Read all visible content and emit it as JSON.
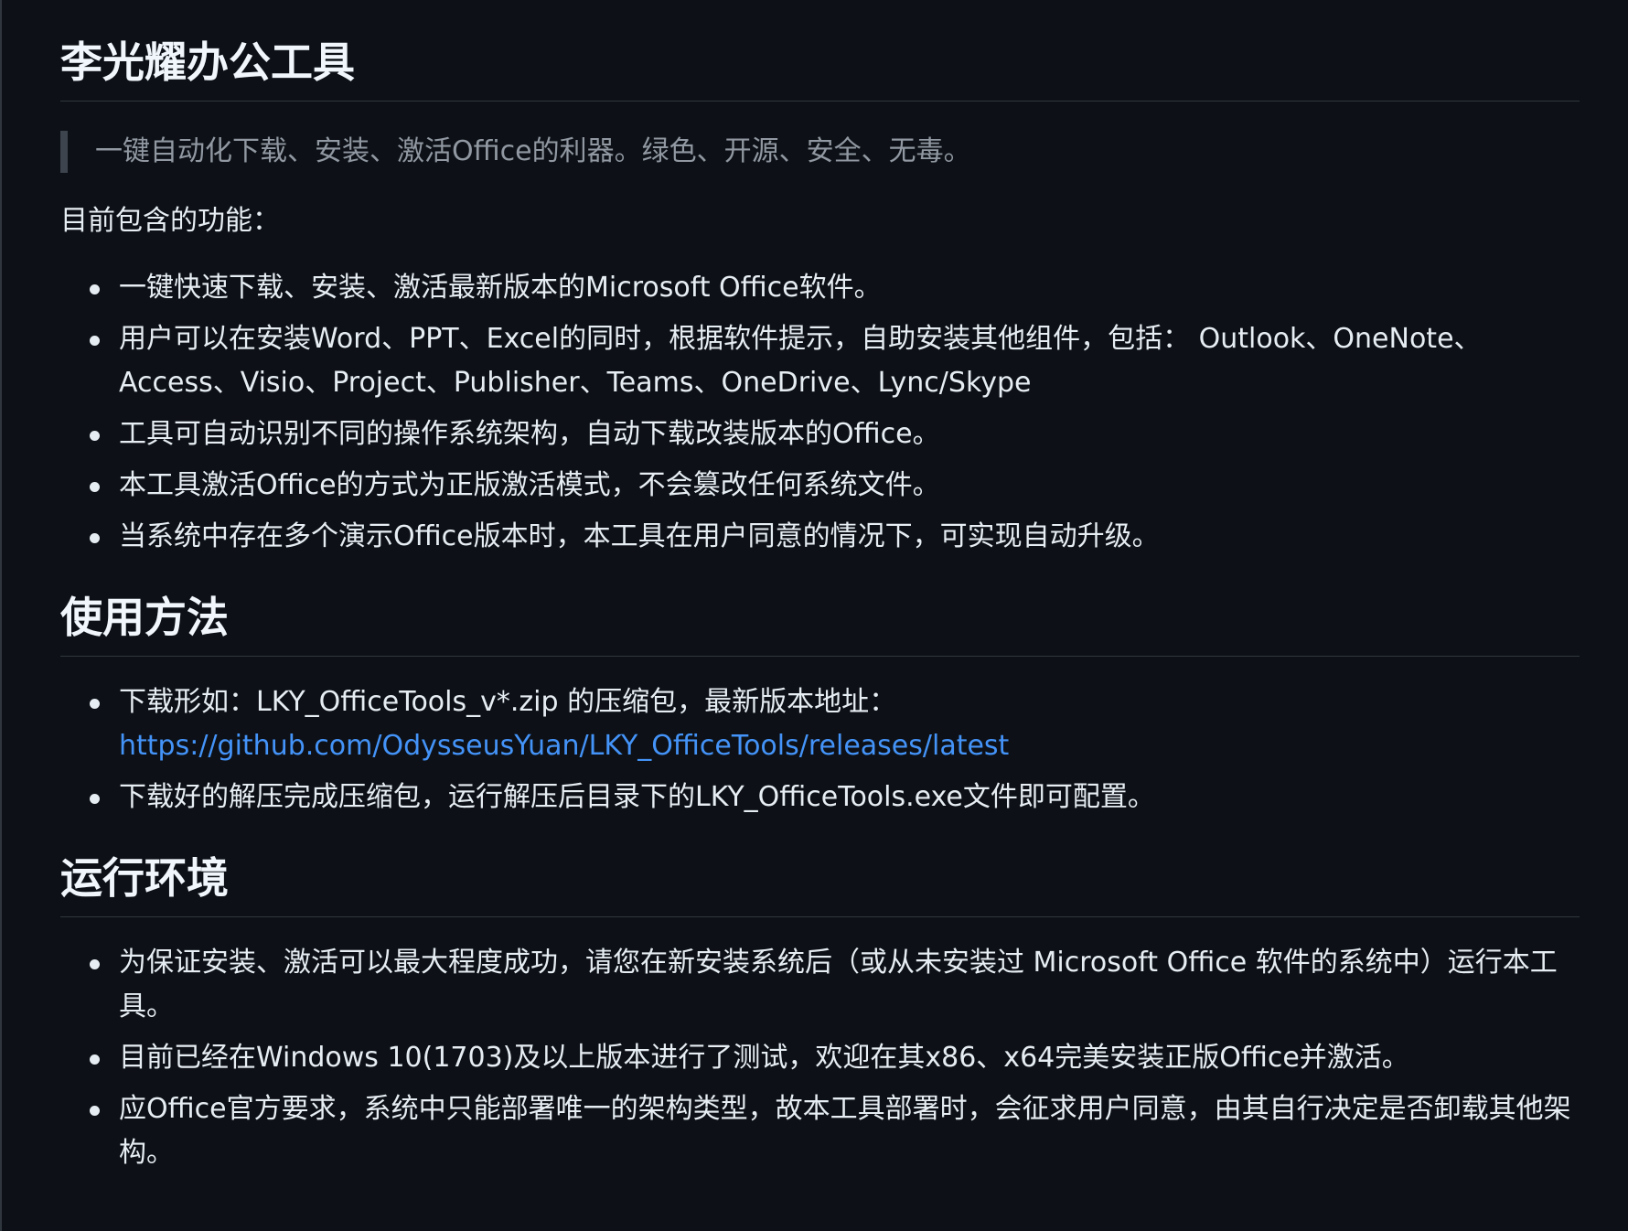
{
  "title": "李光耀办公工具",
  "tagline": "一键自动化下载、安装、激活Office的利器。绿色、开源、安全、无毒。",
  "features_intro": "目前包含的功能：",
  "features": [
    "一键快速下载、安装、激活最新版本的Microsoft Office软件。",
    "用户可以在安装Word、PPT、Excel的同时，根据软件提示，自助安装其他组件，包括： Outlook、OneNote、Access、Visio、Project、Publisher、Teams、OneDrive、Lync/Skype",
    "工具可自动识别不同的操作系统架构，自动下载改装版本的Office。",
    "本工具激活Office的方式为正版激活模式，不会篡改任何系统文件。",
    "当系统中存在多个演示Office版本时，本工具在用户同意的情况下，可实现自动升级。"
  ],
  "usage": {
    "heading": "使用方法",
    "download_text": "下载形如：LKY_OfficeTools_v*.zip 的压缩包，最新版本地址：",
    "download_link": "https://github.com/OdysseusYuan/LKY_OfficeTools/releases/latest",
    "run_text": "下载好的解压完成压缩包，运行解压后目录下的LKY_OfficeTools.exe文件即可配置。"
  },
  "environment": {
    "heading": "运行环境",
    "items": [
      "为保证安装、激活可以最大程度成功，请您在新安装系统后（或从未安装过 Microsoft Office 软件的系统中）运行本工具。",
      "目前已经在Windows 10(1703)及以上版本进行了测试，欢迎在其x86、x64完美安装正版Office并激活。",
      "应Office官方要求，系统中只能部署唯一的架构类型，故本工具部署时，会征求用户同意，由其自行决定是否卸载其他架构。"
    ]
  },
  "colors": {
    "background": "#0d1117",
    "text": "#e6edf3",
    "muted": "#9198a1",
    "link": "#4493f8",
    "border": "#30363d"
  }
}
